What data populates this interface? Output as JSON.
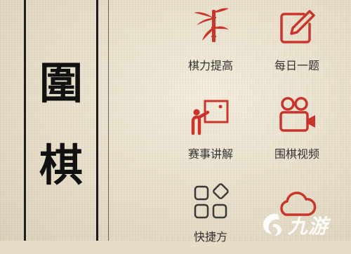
{
  "app": {
    "title_chars": [
      "圍",
      "棋"
    ]
  },
  "menu": {
    "items": [
      {
        "label": "棋力提高",
        "icon": "bamboo-icon"
      },
      {
        "label": "每日一题",
        "icon": "edit-icon"
      },
      {
        "label": "赛事讲解",
        "icon": "lecture-board-icon"
      },
      {
        "label": "围棋视频",
        "icon": "video-camera-icon"
      },
      {
        "label": "快捷方",
        "icon": "grid-shortcuts-icon"
      },
      {
        "label": "",
        "icon": "cloud-icon"
      }
    ]
  },
  "watermark": {
    "text": "九游"
  },
  "colors": {
    "accent": "#c9352b",
    "ink": "#1d1d1d",
    "paper": "#e8dfcb"
  }
}
